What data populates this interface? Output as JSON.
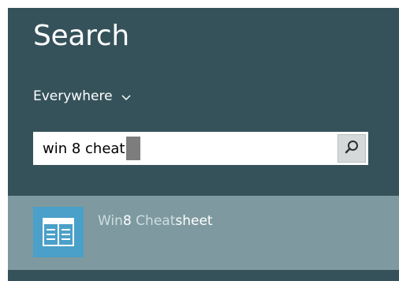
{
  "search_pane": {
    "title": "Search",
    "scope": {
      "label": "Everywhere",
      "icon": "chevron-down-icon"
    },
    "query": {
      "value": "win 8 cheat",
      "icon": "search-icon"
    },
    "results": [
      {
        "icon": "cheatsheet-app-icon",
        "label_parts": [
          "Win",
          "8",
          " Cheat",
          "sheet"
        ]
      }
    ]
  },
  "colors": {
    "pane_background": "#35525a",
    "selected_result": "#7e9aa0",
    "app_tile": "#4aa0c9"
  }
}
